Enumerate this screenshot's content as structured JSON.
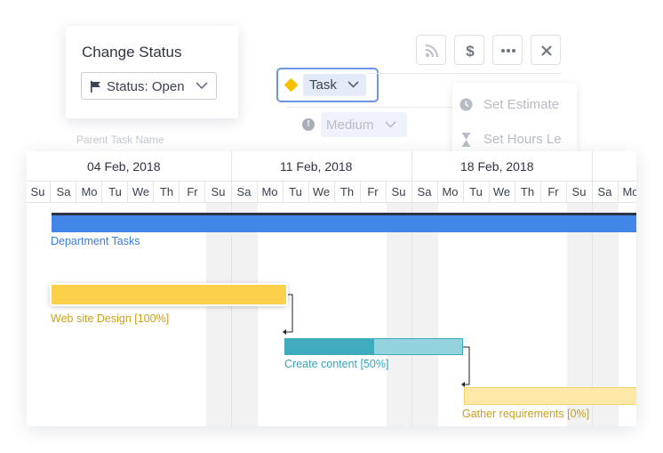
{
  "status_card": {
    "title": "Change Status",
    "status_value": "Status: Open"
  },
  "parent_task_placeholder": "Parent Task Name",
  "task_type": {
    "value": "Task",
    "color": "#f5c000"
  },
  "priority": {
    "value": "Medium"
  },
  "toolbar": {
    "icons": [
      "rss-icon",
      "dollar-icon",
      "more-icon",
      "close-icon"
    ]
  },
  "menu": {
    "items": [
      {
        "label": "Set Estimate",
        "icon": "clock-icon"
      },
      {
        "label": "Set Hours Le",
        "icon": "hourglass-icon"
      }
    ]
  },
  "gantt": {
    "weeks": [
      "04 Feb, 2018",
      "11 Feb, 2018",
      "18 Feb, 2018"
    ],
    "days": [
      "Su",
      "Sa",
      "Mo",
      "Tu",
      "We",
      "Th",
      "Fr",
      "Su",
      "Sa",
      "Mo",
      "Tu",
      "We",
      "Th",
      "Fr",
      "Su",
      "Sa",
      "Mo",
      "Tu",
      "We",
      "Th",
      "Fr",
      "Su",
      "Sa",
      "Mo"
    ],
    "tasks": [
      {
        "label": "Department Tasks",
        "color": "#4286e8",
        "progress": 1.0
      },
      {
        "label": "Web site Design [100%]",
        "color": "#fcd04b",
        "progress": 1.0
      },
      {
        "label": "Create content [50%]",
        "color": "#40aabf",
        "progress": 0.5
      },
      {
        "label": "Gather requirements  [0%]",
        "color": "#fde9a7",
        "progress": 0.0
      }
    ]
  }
}
